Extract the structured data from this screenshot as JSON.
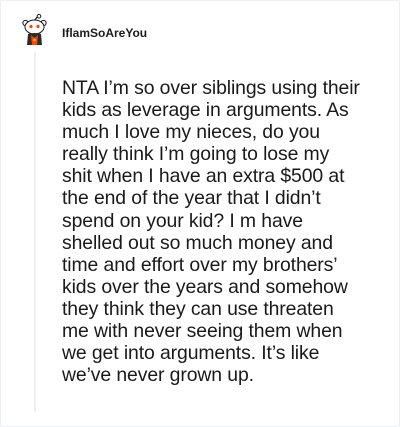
{
  "comment": {
    "author": {
      "username": "IflamSoAreYou",
      "avatar_icon": "snoo-avatar-icon"
    },
    "body": "NTA I’m so over siblings using their kids as leverage in arguments. As much I love my nieces, do you really think I’m going to lose my shit when I have an extra $500 at the end of the year that I didn’t spend on your kid? I m have shelled out so much money and time and effort over my brothers’ kids over the years and somehow they think they can use threaten me with never seeing them when we get into arguments. It’s like we’ve never grown up."
  },
  "colors": {
    "text": "#1a1a1b",
    "thread_line": "#edeff1",
    "avatar_accent": "#ff4500"
  }
}
